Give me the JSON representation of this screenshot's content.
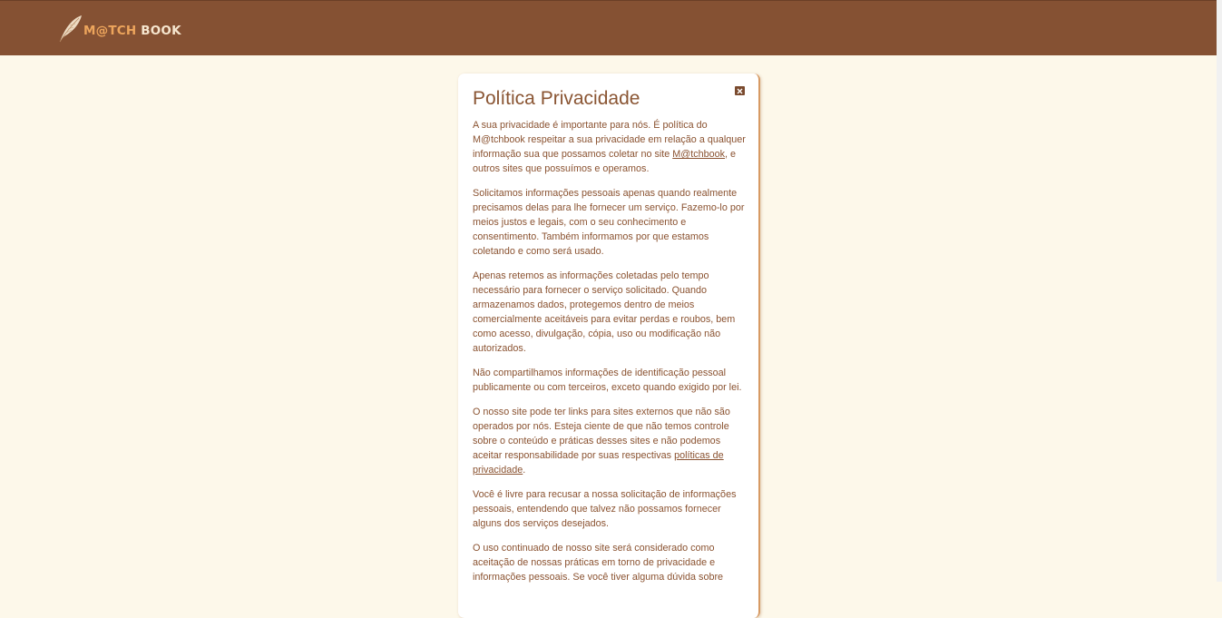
{
  "header": {
    "logo_part1": "M@TCH",
    "logo_part2": "BOOK",
    "bg_color": "#855133",
    "logo_icon": "feather-icon"
  },
  "modal": {
    "title": "Política Privacidade",
    "close_icon": "close-icon",
    "p1_a": "A sua privacidade é importante para nós. É política do M@tchbook respeitar a sua privacidade em relação a qualquer informação sua que possamos coletar no site ",
    "p1_link": "M@tchbook",
    "p1_b": ", e outros sites que possuímos e operamos.",
    "p2": "Solicitamos informações pessoais apenas quando realmente precisamos delas para lhe fornecer um serviço. Fazemo-lo por meios justos e legais, com o seu conhecimento e consentimento. Também informamos por que estamos coletando e como será usado.",
    "p3": "Apenas retemos as informações coletadas pelo tempo necessário para fornecer o serviço solicitado. Quando armazenamos dados, protegemos dentro de meios comercialmente aceitáveis para evitar perdas e roubos, bem como acesso, divulgação, cópia, uso ou modificação não autorizados.",
    "p4": "Não compartilhamos informações de identificação pessoal publicamente ou com terceiros, exceto quando exigido por lei.",
    "p5_a": "O nosso site pode ter links para sites externos que não são operados por nós. Esteja ciente de que não temos controle sobre o conteúdo e práticas desses sites e não podemos aceitar responsabilidade por suas respectivas ",
    "p5_link": "políticas de privacidade",
    "p5_b": ".",
    "p6": "Você é livre para recusar a nossa solicitação de informações pessoais, entendendo que talvez não possamos fornecer alguns dos serviços desejados.",
    "p7": "O uso continuado de nosso site será considerado como aceitação de nossas práticas em torno de privacidade e informações pessoais. Se você tiver alguma dúvida sobre"
  }
}
